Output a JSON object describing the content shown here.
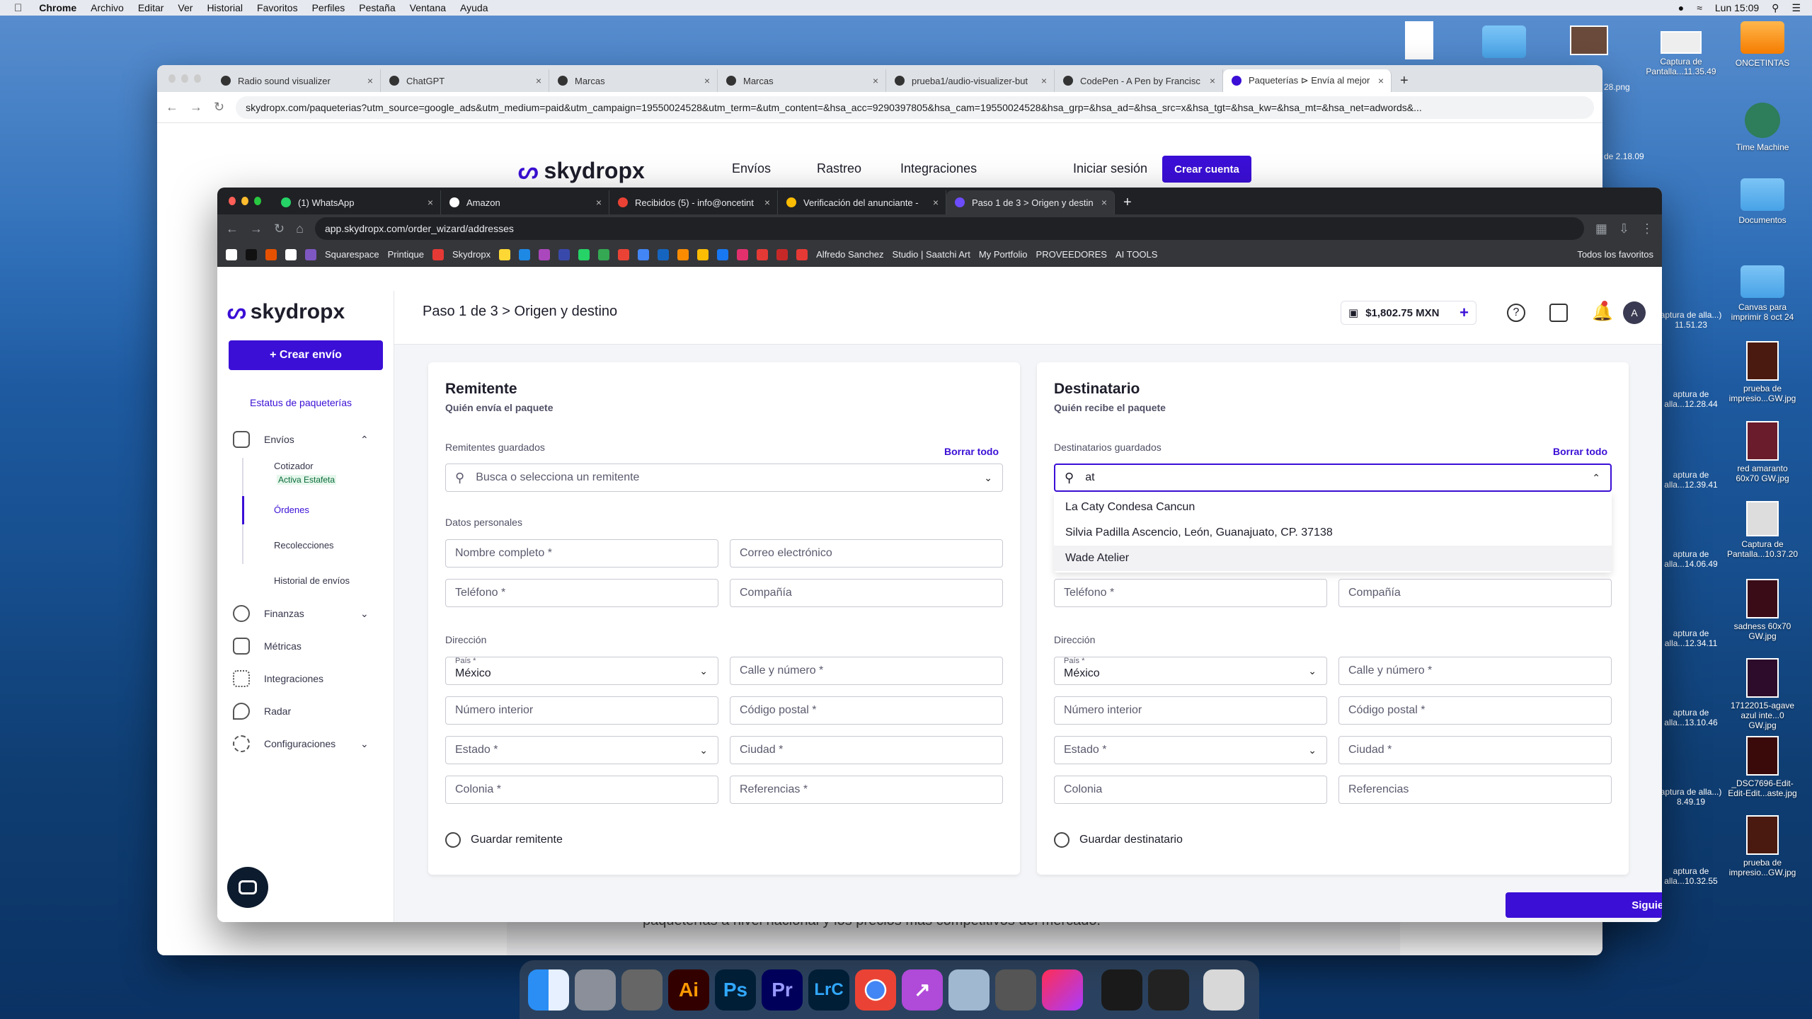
{
  "menubar": {
    "app": "Chrome",
    "items": [
      "Archivo",
      "Editar",
      "Ver",
      "Historial",
      "Favoritos",
      "Perfiles",
      "Pestaña",
      "Ventana",
      "Ayuda"
    ],
    "clock": "Lun 15:09"
  },
  "desktop": {
    "icons": [
      {
        "label": "ONCETINTAS"
      },
      {
        "label": "Time Machine"
      },
      {
        "label": "Documentos"
      },
      {
        "label": "Canvas para imprimir 8 oct 24"
      },
      {
        "label": "prueba de impresio...GW.jpg"
      },
      {
        "label": "red amaranto 60x70 GW.jpg"
      },
      {
        "label": "Captura de Pantalla...10.37.20"
      },
      {
        "label": "sadness 60x70 GW.jpg"
      },
      {
        "label": "17122015-agave azul inte...0 GW.jpg"
      },
      {
        "label": "_DSC7696-Edit-Edit-Edit...aste.jpg"
      },
      {
        "label": "prueba de impresio...GW.jpg"
      }
    ],
    "partial_labels": [
      "28.png",
      "Captura de Pantalla...11.35.49",
      "de 2.18.09",
      "aptura de alla...) 11.51.23",
      "aptura de alla...12.28.44",
      "aptura de alla...12.39.41",
      "aptura de alla...14.06.49",
      "aptura de alla...12.34.11",
      "aptura de alla...13.10.46",
      "aptura de alla...) 8.49.19",
      "aptura de alla...10.32.55"
    ]
  },
  "back_window": {
    "tabs": [
      {
        "label": "Radio sound visualizer"
      },
      {
        "label": "ChatGPT"
      },
      {
        "label": "Marcas"
      },
      {
        "label": "Marcas"
      },
      {
        "label": "prueba1/audio-visualizer-but"
      },
      {
        "label": "CodePen - A Pen by Francisc"
      },
      {
        "label": "Paqueterías ⊳ Envía al mejor"
      }
    ],
    "url": "skydropx.com/paqueterias?utm_source=google_ads&utm_medium=paid&utm_campaign=19550024528&utm_term=&utm_content=&hsa_acc=9290397805&hsa_cam=19550024528&hsa_grp=&hsa_ad=&hsa_src=x&hsa_tgt=&hsa_kw=&hsa_mt=&hsa_net=adwords&...",
    "site_nav": {
      "logo": "skydropx",
      "items": [
        "Envíos",
        "Rastreo",
        "Integraciones"
      ],
      "login": "Iniciar sesión",
      "signup": "Crear cuenta"
    },
    "footer_text": "paqueterías a nivel nacional y los precios más competitivos del mercado."
  },
  "front_window": {
    "tabs": [
      {
        "label": "(1) WhatsApp"
      },
      {
        "label": "Amazon"
      },
      {
        "label": "Recibidos (5) - info@oncetint"
      },
      {
        "label": "Verificación del anunciante -"
      },
      {
        "label": "Paso 1 de 3 > Origen y destin"
      }
    ],
    "url": "app.skydropx.com/order_wizard/addresses",
    "bookmarks": [
      "Squarespace",
      "Printique",
      "Skydropx",
      "Alfredo Sanchez",
      "Studio | Saatchi Art",
      "My Portfolio",
      "PROVEEDORES",
      "AI TOOLS",
      "Todos los favoritos"
    ]
  },
  "app": {
    "logo": "skydropx",
    "create_button": "+ Crear envío",
    "status_link": "Estatus de paqueterías",
    "nav": {
      "envios": "Envíos",
      "cotizador": "Cotizador",
      "cotizador_badge": "Activa Estafeta",
      "ordenes": "Órdenes",
      "recolecciones": "Recolecciones",
      "historial": "Historial de envíos",
      "finanzas": "Finanzas",
      "metricas": "Métricas",
      "integraciones": "Integraciones",
      "radar": "Radar",
      "configuraciones": "Configuraciones"
    },
    "header": {
      "breadcrumb": "Paso 1 de 3 > Origen y destino",
      "balance": "$1,802.75 MXN",
      "avatar": "A"
    },
    "remitente": {
      "title": "Remitente",
      "subtitle": "Quién envía el paquete",
      "saved_label": "Remitentes guardados",
      "clear": "Borrar todo",
      "search_placeholder": "Busca o selecciona un remitente",
      "personal_label": "Datos personales",
      "nombre": "Nombre completo *",
      "correo": "Correo electrónico",
      "telefono": "Teléfono *",
      "compania": "Compañía",
      "direccion_label": "Dirección",
      "pais_label": "País *",
      "pais": "México",
      "calle": "Calle y número *",
      "interior": "Número interior",
      "cp": "Código postal *",
      "estado": "Estado *",
      "ciudad": "Ciudad *",
      "colonia": "Colonia *",
      "referencias": "Referencias *",
      "save": "Guardar remitente"
    },
    "destinatario": {
      "title": "Destinatario",
      "subtitle": "Quién recibe el paquete",
      "saved_label": "Destinatarios guardados",
      "clear": "Borrar todo",
      "search_value": "at",
      "options": [
        "La Caty Condesa Cancun",
        "Silvia Padilla Ascencio, León, Guanajuato, CP. 37138",
        "Wade Atelier"
      ],
      "telefono": "Teléfono *",
      "compania": "Compañía",
      "direccion_label": "Dirección",
      "pais_label": "País *",
      "pais": "México",
      "calle": "Calle y número *",
      "interior": "Número interior",
      "cp": "Código postal *",
      "estado": "Estado *",
      "ciudad": "Ciudad *",
      "colonia": "Colonia",
      "referencias": "Referencias",
      "save": "Guardar destinatario"
    },
    "next_button": "Siguiente"
  },
  "dock": {
    "apps": [
      "Finder",
      "Launchpad",
      "System Preferences",
      "Illustrator",
      "Photoshop",
      "Premiere",
      "Lightroom Classic",
      "Chrome",
      "Migration",
      "Preview",
      "Calculator",
      "Creative Cloud",
      "Activity",
      "Screenshot",
      "Trash"
    ]
  }
}
